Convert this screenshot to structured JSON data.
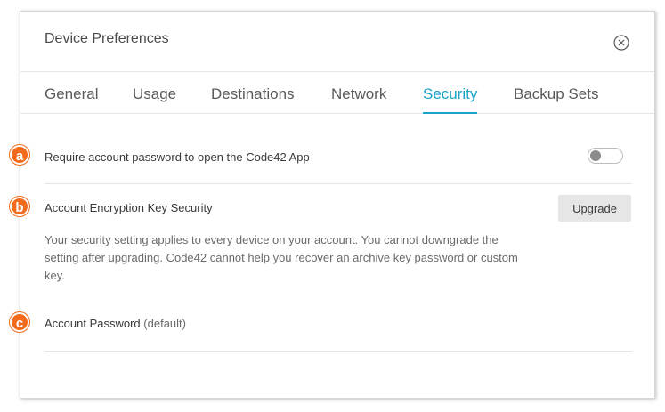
{
  "dialog": {
    "title": "Device Preferences",
    "close_icon": "close-circle-icon"
  },
  "tabs": [
    {
      "label": "General",
      "active": false
    },
    {
      "label": "Usage",
      "active": false
    },
    {
      "label": "Destinations",
      "active": false
    },
    {
      "label": "Network",
      "active": false
    },
    {
      "label": "Security",
      "active": true
    },
    {
      "label": "Backup Sets",
      "active": false
    }
  ],
  "security": {
    "require_password": {
      "badge": "a",
      "label": "Require account password to open the Code42 App",
      "enabled": false
    },
    "encryption": {
      "badge": "b",
      "label": "Account Encryption Key Security",
      "upgrade_label": "Upgrade",
      "description": "Your security setting applies to every device on your account. You cannot downgrade the setting after upgrading. Code42 cannot help you recover an archive key password or custom key."
    },
    "account_password": {
      "badge": "c",
      "label": "Account Password",
      "suffix": "(default)"
    }
  },
  "colors": {
    "accent": "#1aa3c9",
    "badge": "#f26a1b"
  }
}
